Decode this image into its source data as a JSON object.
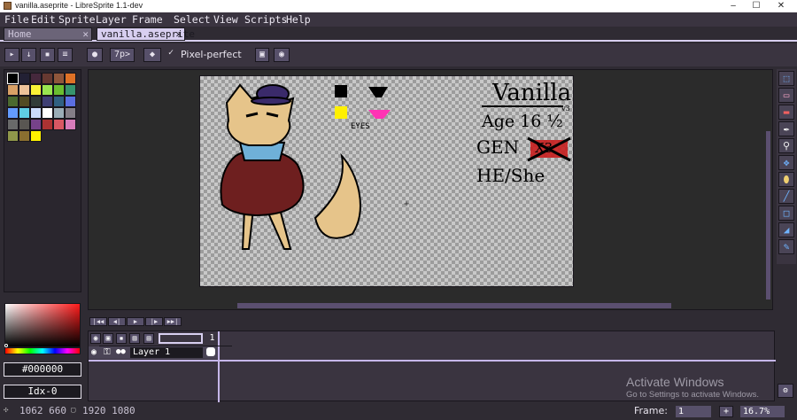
{
  "window": {
    "title": "vanilla.aseprite - LibreSprite 1.1-dev",
    "minimize": "–",
    "maximize": "☐",
    "close": "✕"
  },
  "menu": [
    "File",
    "Edit",
    "Sprite",
    "Layer",
    "Frame",
    "Select",
    "View",
    "Scripts",
    "Help"
  ],
  "tabs": [
    {
      "label": "Home",
      "close": "✕",
      "active": false
    },
    {
      "label": "vanilla.aseprite",
      "close": "✕",
      "active": true
    }
  ],
  "context": {
    "brush_size": "7p>",
    "pixel_perfect": "Pixel-perfect",
    "check": "✓"
  },
  "palette_colors": [
    "#000000",
    "#222034",
    "#45283c",
    "#663931",
    "#8f563b",
    "#df7126",
    "#d9a066",
    "#eec39a",
    "#fbf236",
    "#99e550",
    "#6abe30",
    "#37946e",
    "#4b692f",
    "#524b24",
    "#323c39",
    "#3f3f74",
    "#306082",
    "#5b6ee1",
    "#639bff",
    "#5fcde4",
    "#cbdbfc",
    "#ffffff",
    "#9badb7",
    "#847e87",
    "#696a6a",
    "#595652",
    "#76428a",
    "#ac3232",
    "#d95763",
    "#d77bba",
    "#8f974a",
    "#8a6f30",
    "#fff200"
  ],
  "color": {
    "hex": "#000000",
    "index": "Idx-0"
  },
  "artwork": {
    "title": "Vanilla",
    "age": "Age 16 ½",
    "gen": "GEN",
    "gen_crossed": "X3",
    "pronouns": "HE/She",
    "eyes_label": "EYES",
    "corner_note": "v3"
  },
  "timeline": {
    "layers": [
      {
        "name": "Layer 1"
      }
    ],
    "frame_number": "1",
    "playback": [
      "|◀◀",
      "◀|",
      "▶",
      "|▶",
      "▶▶|"
    ]
  },
  "status": {
    "position": "1062 660",
    "size": "1920 1080",
    "frame_label": "Frame:",
    "frame_value": "1",
    "zoom": "16.7%",
    "add": "+"
  },
  "watermark": {
    "line1": "Activate Windows",
    "line2": "Go to Settings to activate Windows."
  },
  "colors": {
    "accent": "#d8cff0",
    "panel": "#3a3440",
    "background": "#2f2b33"
  }
}
